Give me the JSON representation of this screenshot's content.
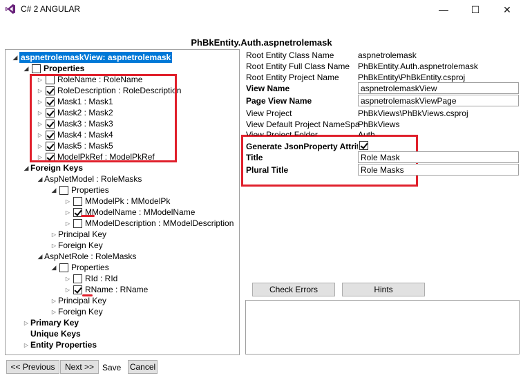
{
  "window": {
    "title": "C# 2 ANGULAR",
    "minimize_glyph": "—",
    "maximize_glyph": "☐",
    "close_glyph": "✕"
  },
  "page": {
    "heading": "PhBkEntity.Auth.aspnetrolemask"
  },
  "tree": {
    "root": "aspnetrolemaskView: aspnetrolemask",
    "properties": "Properties",
    "role_name": "RoleName : RoleName",
    "role_description": "RoleDescription : RoleDescription",
    "mask1": "Mask1 : Mask1",
    "mask2": "Mask2 : Mask2",
    "mask3": "Mask3 : Mask3",
    "mask4": "Mask4 : Mask4",
    "mask5": "Mask5 : Mask5",
    "model_pk_ref": "ModelPkRef : ModelPkRef",
    "foreign_keys": "Foreign Keys",
    "aspnet_model": "AspNetModel : RoleMasks",
    "am_properties": "Properties",
    "mmodel_pk": "MModelPk : MModelPk",
    "mmodel_name": "MModelName : MModelName",
    "mmodel_description": "MModelDescription : MModelDescription",
    "am_principal_key": "Principal Key",
    "am_foreign_key": "Foreign Key",
    "aspnet_role": "AspNetRole : RoleMasks",
    "ar_properties": "Properties",
    "rid": "RId : RId",
    "rname": "RName : RName",
    "ar_principal_key": "Principal Key",
    "ar_foreign_key": "Foreign Key",
    "primary_key": "Primary Key",
    "unique_keys": "Unique Keys",
    "entity_properties": "Entity Properties"
  },
  "details": {
    "root_entity_class_name_label": "Root Entity Class Name",
    "root_entity_class_name": "aspnetrolemask",
    "root_entity_full_class_name_label": "Root Entity Full Class Name",
    "root_entity_full_class_name": "PhBkEntity.Auth.aspnetrolemask",
    "root_entity_project_name_label": "Root Entity Project Name",
    "root_entity_project_name": "PhBkEntity\\PhBkEntity.csproj",
    "view_name_label": "View Name",
    "view_name": "aspnetrolemaskView",
    "page_view_name_label": "Page View Name",
    "page_view_name": "aspnetrolemaskViewPage",
    "view_project_label": "View Project",
    "view_project": "PhBkViews\\PhBkViews.csproj",
    "view_default_namespace_label": "View Default Project NameSpa",
    "view_default_namespace": "PhBkViews",
    "view_project_folder_label": "View Project Folder",
    "view_project_folder": "Auth",
    "generate_json_label": "Generate JsonProperty Attrit",
    "title_label": "Title",
    "title": "Role Mask",
    "plural_title_label": "Plural Title",
    "plural_title": "Role Masks"
  },
  "actions": {
    "check_errors": "Check Errors",
    "hints": "Hints",
    "previous": "<< Previous",
    "next": "Next >>",
    "save": "Save",
    "cancel": "Cancel"
  },
  "colors": {
    "highlight_red": "#e0202c",
    "selection_blue": "#0078d7"
  }
}
